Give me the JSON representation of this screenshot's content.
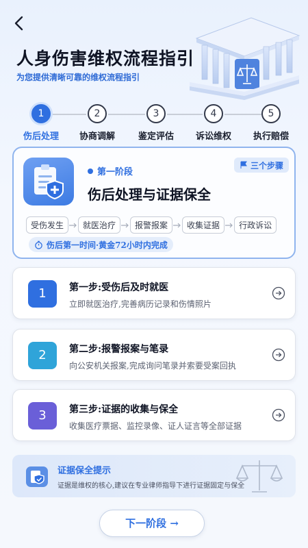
{
  "header": {
    "title": "人身伤害维权流程指引",
    "subtitle": "为您提供清晰可靠的维权流程指引"
  },
  "progress": {
    "current_step": 1,
    "steps": [
      {
        "num": "1",
        "label": "伤后处理"
      },
      {
        "num": "2",
        "label": "协商调解"
      },
      {
        "num": "3",
        "label": "鉴定评估"
      },
      {
        "num": "4",
        "label": "诉讼维权"
      },
      {
        "num": "5",
        "label": "执行赔偿"
      }
    ]
  },
  "stage": {
    "tag": "第一阶段",
    "badge": "三个步骤",
    "title": "伤后处理与证据保全",
    "flow": [
      "受伤发生",
      "就医治疗",
      "报警报案",
      "收集证据",
      "行政诉讼"
    ],
    "time_note": "伤后第一时间·黄金72小时内完成"
  },
  "step_cards": [
    {
      "num": "1",
      "title": "第一步:受伤后及时就医",
      "desc": "立即就医治疗,完善病历记录和伤情照片",
      "color": "#2f6fe0"
    },
    {
      "num": "2",
      "title": "第二步:报警报案与笔录",
      "desc": "向公安机关报案,完成询问笔录并索要受案回执",
      "color": "#2fa4d9"
    },
    {
      "num": "3",
      "title": "第三步:证据的收集与保全",
      "desc": "收集医疗票据、监控录像、证人证言等全部证据",
      "color": "#6a5fd8"
    }
  ],
  "tip": {
    "title": "证据保全提示",
    "text": "证据是维权的核心,建议在专业律师指导下进行证据固定与保全"
  },
  "footer": {
    "next_label": "下一阶段 →"
  },
  "colors": {
    "accent": "#2f6fe0",
    "step2": "#2fa4d9",
    "step3": "#6a5fd8"
  }
}
